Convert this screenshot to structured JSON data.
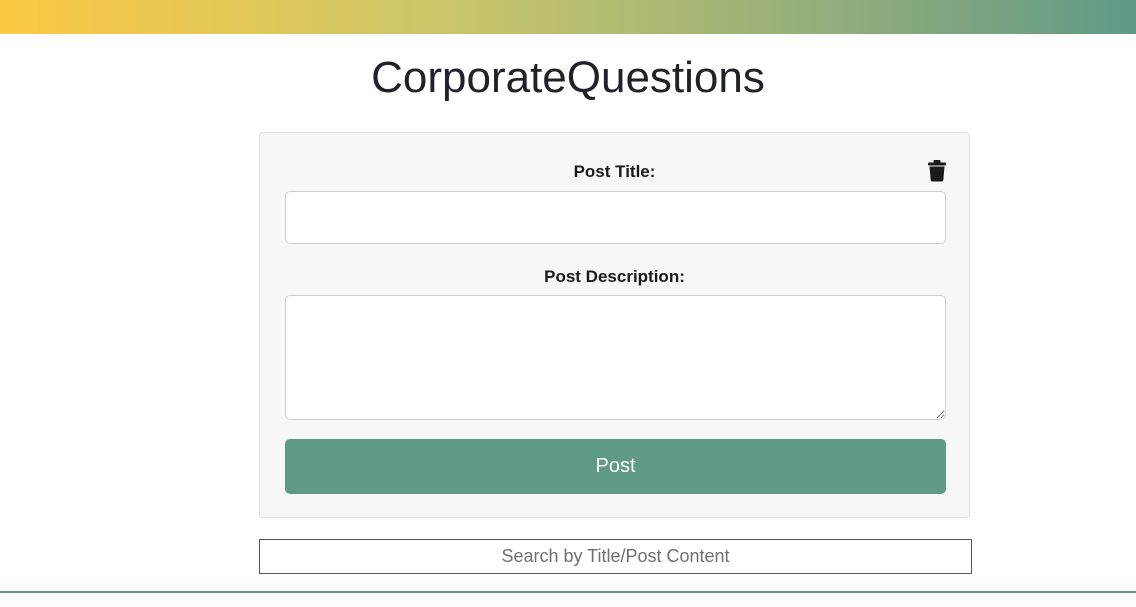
{
  "header": {
    "title": "CorporateQuestions",
    "bar_gradient": [
      "#fdc944",
      "#5f9a86"
    ]
  },
  "post_form": {
    "title_label": "Post Title:",
    "title_value": "",
    "description_label": "Post Description:",
    "description_value": "",
    "submit_label": "Post",
    "clear_icon": "trash-icon",
    "accent_color": "#5f9a86"
  },
  "search": {
    "placeholder": "Search by Title/Post Content",
    "value": ""
  }
}
